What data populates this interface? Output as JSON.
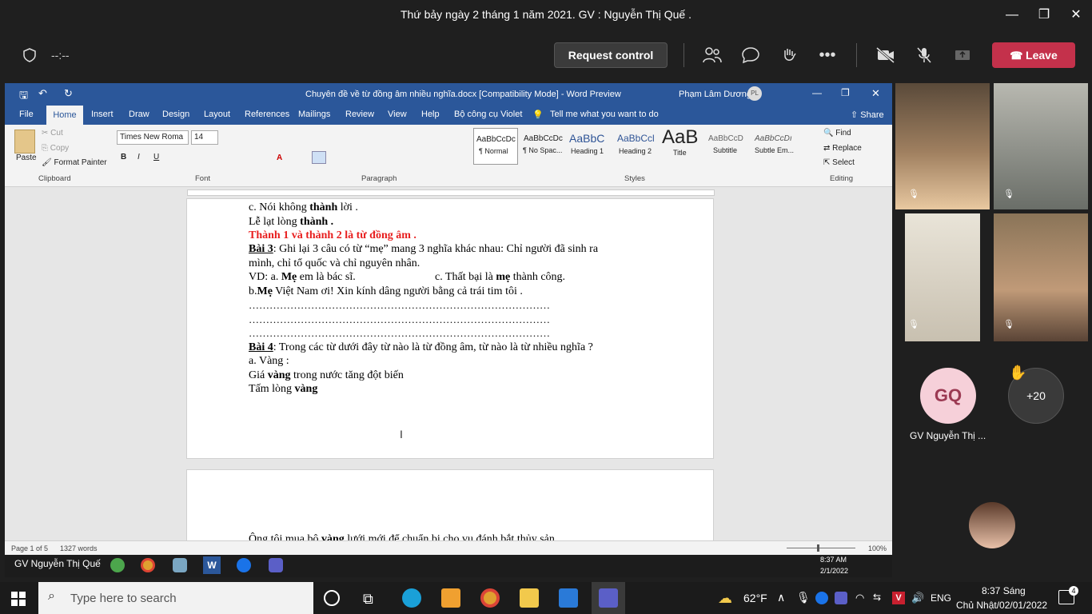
{
  "meeting": {
    "title": "Thứ bảy ngày 2 tháng 1 năm 2021. GV : Nguyễn Thị Quế .",
    "timer": "--:--",
    "request_control": "Request control",
    "leave": "Leave"
  },
  "word": {
    "doc_title": "Chuyên đề về từ đồng âm nhiều nghĩa.docx [Compatibility Mode]  -  Word Preview",
    "user": "Phạm Lâm Dương",
    "user_initials": "PL",
    "tabs": [
      "File",
      "Home",
      "Insert",
      "Draw",
      "Design",
      "Layout",
      "References",
      "Mailings",
      "Review",
      "View",
      "Help",
      "Bộ công cụ Violet"
    ],
    "tell_me": "Tell me what you want to do",
    "share": "Share",
    "clipboard": {
      "paste": "Paste",
      "cut": "Cut",
      "copy": "Copy",
      "format_painter": "Format Painter",
      "label": "Clipboard"
    },
    "font": {
      "name": "Times New Roma",
      "size": "14",
      "label": "Font"
    },
    "paragraph_label": "Paragraph",
    "styles": [
      {
        "sample": "AaBbCcDc",
        "name": "¶ Normal"
      },
      {
        "sample": "AaBbCcDc",
        "name": "¶ No Spac..."
      },
      {
        "sample": "AaBbC",
        "name": "Heading 1"
      },
      {
        "sample": "AaBbCcl",
        "name": "Heading 2"
      },
      {
        "sample": "AaB",
        "name": "Title"
      },
      {
        "sample": "AaBbCcD",
        "name": "Subtitle"
      },
      {
        "sample": "AaBbCcDı",
        "name": "Subtle Em..."
      }
    ],
    "styles_label": "Styles",
    "editing": {
      "find": "Find",
      "replace": "Replace",
      "select": "Select",
      "label": "Editing"
    },
    "status": {
      "page": "Page 1 of 5",
      "words": "1327 words",
      "zoom": "100%"
    }
  },
  "document": {
    "l1a": "c. Nói không ",
    "l1b": "thành",
    "l1c": " lời  .",
    "l2a": "Lễ lạt lòng ",
    "l2b": "thành .",
    "l3": "Thành 1 và thành 2 là từ đồng âm .",
    "l4a": "Bài 3",
    "l4b": ": Ghi lại 3 câu có từ “mẹ” mang 3 nghĩa khác nhau: Chỉ người đã sinh ra",
    "l5": "mình, chỉ tổ quốc và chỉ nguyên nhân.",
    "l6a": "VD: a. ",
    "l6b": "Mẹ",
    "l6c": " em là bác sĩ.",
    "l6d": "c. Thất bại là ",
    "l6e": "mẹ",
    "l6f": " thành công.",
    "l7a": "b.",
    "l7b": "Mẹ",
    "l7c": " Việt Nam ơi! Xin kính dâng người bằng cả trái tim tôi  .",
    "dots": "……………………………………………………………………………",
    "l11a": "Bài 4",
    "l11b": ": Trong các từ dưới đây từ nào là từ đồng âm, từ nào là từ nhiều nghĩa ?",
    "l12": "a. Vàng :",
    "l13a": "Giá ",
    "l13b": "vàng",
    "l13c": " trong nước tăng đột biến",
    "l14a": "Tấm lòng ",
    "l14b": "vàng",
    "p2a": "Ông tôi mua bộ ",
    "p2b": "vàng",
    "p2c": " lưới mới để chuẩn bị cho vụ đánh bắt thủy sản"
  },
  "remote_taskbar": {
    "user": "GV Nguyễn Thị Quế",
    "time": "8:37 AM",
    "date": "2/1/2022"
  },
  "participants": {
    "gq_initials": "GQ",
    "gq_name": "GV Nguyễn Thị ...",
    "more": "+20"
  },
  "taskbar": {
    "search": "Type here to search",
    "weather": "62°F",
    "lang": "ENG",
    "time": "8:37 Sáng",
    "date": "Chủ Nhật/02/01/2022",
    "notif": "4"
  },
  "colors": {
    "word_blue": "#2b579a",
    "leave_red": "#c4314b",
    "heading_red": "#e81e1e",
    "gq_pink": "#f6d0d9"
  }
}
